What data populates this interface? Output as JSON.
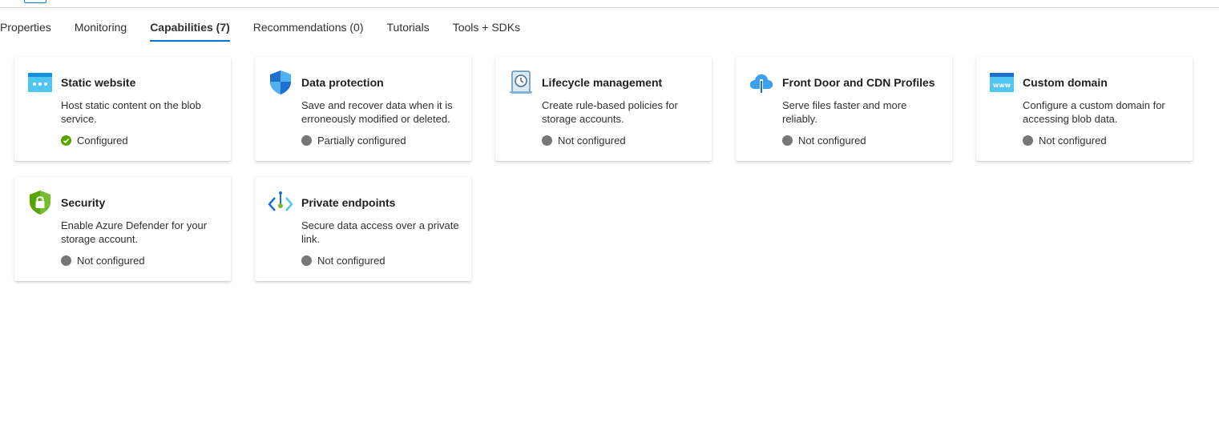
{
  "tabs": [
    {
      "label": "Properties"
    },
    {
      "label": "Monitoring"
    },
    {
      "label": "Capabilities (7)"
    },
    {
      "label": "Recommendations (0)"
    },
    {
      "label": "Tutorials"
    },
    {
      "label": "Tools + SDKs"
    }
  ],
  "active_tab": "Capabilities (7)",
  "colors": {
    "accent": "#0078d4",
    "configured": "#57a300",
    "not_configured": "#797775"
  },
  "cards": [
    {
      "icon": "static-website-icon",
      "title": "Static website",
      "description": "Host static content on the blob service.",
      "status": "Configured"
    },
    {
      "icon": "shield-icon",
      "title": "Data protection",
      "description": "Save and recover data when it is erroneously modified or deleted.",
      "status": "Partially configured"
    },
    {
      "icon": "lifecycle-scroll-clock-icon",
      "title": "Lifecycle management",
      "description": "Create rule-based policies for storage accounts.",
      "status": "Not configured"
    },
    {
      "icon": "cloud-cdn-icon",
      "title": "Front Door and CDN Profiles",
      "description": "Serve files faster and more reliably.",
      "status": "Not configured"
    },
    {
      "icon": "www-icon",
      "title": "Custom domain",
      "description": "Configure a custom domain for accessing blob data.",
      "status": "Not configured"
    },
    {
      "icon": "lock-shield-icon",
      "title": "Security",
      "description": "Enable Azure Defender for your storage account.",
      "status": "Not configured"
    },
    {
      "icon": "private-endpoint-icon",
      "title": "Private endpoints",
      "description": "Secure data access over a private link.",
      "status": "Not configured"
    }
  ]
}
